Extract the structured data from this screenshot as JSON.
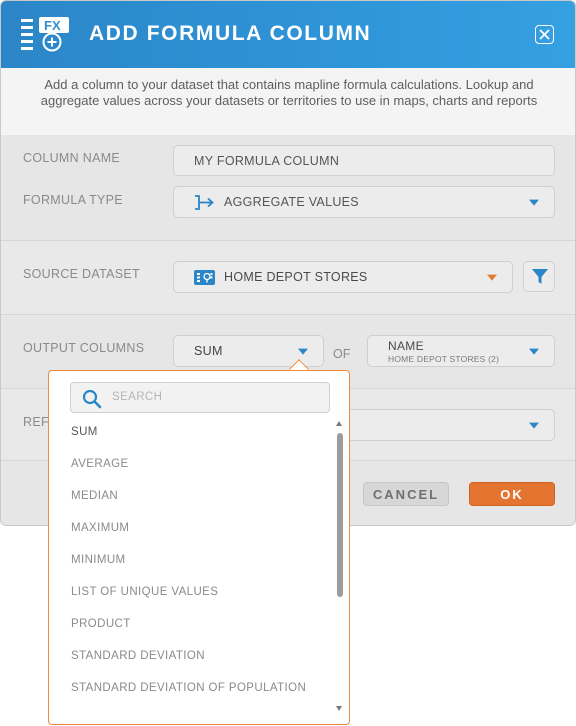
{
  "header": {
    "title": "ADD FORMULA COLUMN",
    "icon_text": "FX",
    "icon": "formula-add-icon",
    "close_icon": "close-icon"
  },
  "description": "Add a column to your dataset that contains mapline formula calculations. Lookup and aggregate values across your datasets or territories to use in maps, charts and reports",
  "form": {
    "column_name_label": "COLUMN NAME",
    "column_name_value": "MY FORMULA COLUMN",
    "formula_type_label": "FORMULA TYPE",
    "formula_type_value": "AGGREGATE VALUES",
    "formula_type_icon": "aggregate-icon",
    "source_dataset_label": "SOURCE DATASET",
    "source_dataset_value": "HOME DEPOT STORES",
    "source_dataset_icon": "dataset-icon",
    "filter_icon": "filter-icon",
    "output_columns_label": "OUTPUT COLUMNS",
    "output_function_value": "SUM",
    "of_label": "OF",
    "output_column_value": "NAME",
    "output_column_sub": "HOME DEPOT STORES (2)",
    "ref_label_partial": "REF"
  },
  "footer": {
    "cancel_label": "CANCEL",
    "ok_label": "OK"
  },
  "dropdown": {
    "search_placeholder": "SEARCH",
    "selected": "SUM",
    "options": [
      "SUM",
      "AVERAGE",
      "MEDIAN",
      "MAXIMUM",
      "MINIMUM",
      "LIST OF UNIQUE VALUES",
      "PRODUCT",
      "STANDARD DEVIATION",
      "STANDARD DEVIATION OF POPULATION"
    ]
  },
  "colors": {
    "header_blue": "#2f95d9",
    "accent_orange": "#e47430",
    "caret_blue": "#2b86c7"
  }
}
